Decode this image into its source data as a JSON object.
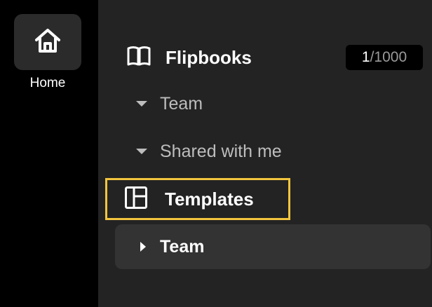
{
  "rail": {
    "home_label": "Home"
  },
  "panel": {
    "flipbooks": {
      "label": "Flipbooks",
      "count_current": "1",
      "count_separator": "/",
      "count_total": "1000"
    },
    "items": [
      {
        "label": "Team",
        "expanded": true
      },
      {
        "label": "Shared with me",
        "expanded": true
      }
    ],
    "templates": {
      "label": "Templates",
      "highlighted": true
    },
    "templates_items": [
      {
        "label": "Team",
        "expanded": false
      }
    ]
  },
  "icons": {
    "home": "home-icon",
    "flipbooks": "open-book-icon",
    "templates": "template-layout-icon",
    "expanded": "caret-down-icon",
    "collapsed": "caret-right-icon"
  },
  "colors": {
    "background": "#000000",
    "panel": "#232323",
    "highlight_border": "#f2c53d",
    "hover_row": "#333333",
    "text_primary": "#ffffff",
    "text_secondary": "#bdbdbd"
  }
}
